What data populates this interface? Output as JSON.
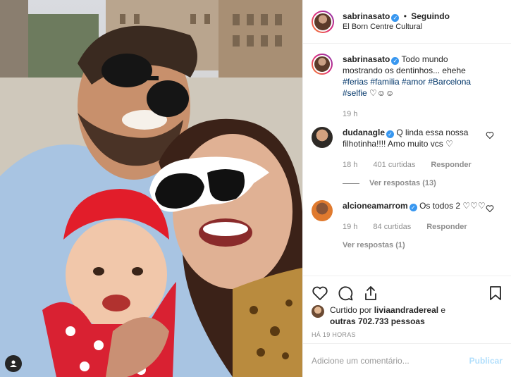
{
  "header": {
    "username": "sabrinasato",
    "follow_status": "Seguindo",
    "location": "El Born Centre Cultural"
  },
  "caption": {
    "username": "sabrinasato",
    "text": "Todo mundo mostrando os dentinhos... ehehe",
    "hashtags": "#ferias #familia #amor #Barcelona #selfie",
    "emojis": "♡☺☺",
    "time": "19 h"
  },
  "comments": [
    {
      "username": "dudanagle",
      "text": "Q linda essa nossa filhotinha!!!! Amo muito vcs ♡",
      "time": "18 h",
      "likes": "401 curtidas",
      "reply": "Responder",
      "view_replies": "Ver respostas (13)"
    },
    {
      "username": "alcioneamarrom",
      "text": "Os todos 2 ♡♡♡",
      "time": "19 h",
      "likes": "84 curtidas",
      "reply": "Responder",
      "view_replies": "Ver respostas (1)"
    }
  ],
  "likes": {
    "prefix": "Curtido por ",
    "user": "liviaandradereal",
    "middle": " e",
    "others": "outras 702.733 pessoas"
  },
  "time_ago": "HÁ 19 HORAS",
  "comment_box": {
    "placeholder": "Adicione um comentário...",
    "publish": "Publicar"
  },
  "colors": {
    "link": "#003569",
    "verified": "#3897f0",
    "muted": "#8e8e8e",
    "publish_disabled": "#b2dffc"
  }
}
